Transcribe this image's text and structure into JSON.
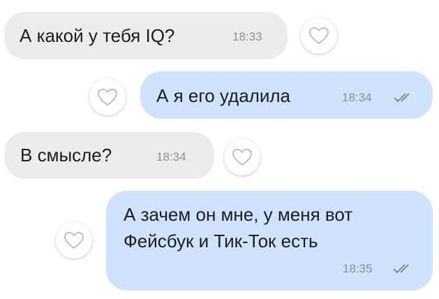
{
  "messages": [
    {
      "text": "А какой у тебя IQ?",
      "time": "18:33",
      "direction": "incoming"
    },
    {
      "text": "А я его удалила",
      "time": "18:34",
      "direction": "outgoing",
      "status": "read-double-check"
    },
    {
      "text": "В смысле?",
      "time": "18:34",
      "direction": "incoming"
    },
    {
      "lines": [
        "А зачем он мне, у меня вот",
        "Фейсбук и Тик-Ток есть"
      ],
      "time": "18:35",
      "direction": "outgoing",
      "status": "read-double-check"
    }
  ],
  "colors": {
    "incoming_bg": "#ececec",
    "outgoing_bg": "#cfe3fe",
    "time": "#8c8f94",
    "check": "#7a7f87"
  },
  "icons": {
    "like": "heart-outline-icon",
    "status": "double-check-icon"
  }
}
